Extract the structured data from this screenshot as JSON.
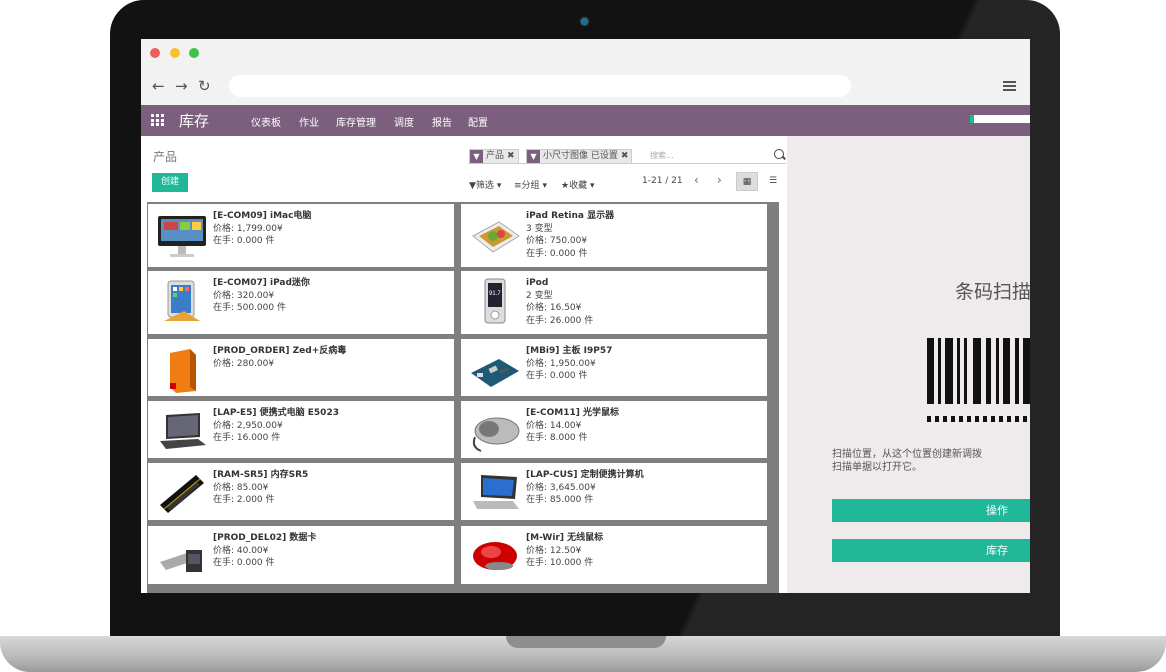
{
  "colors": {
    "brand": "#7c5f7f",
    "accent": "#21b799",
    "close": "#ee5f5b",
    "minimize": "#f7c12f",
    "maximize": "#3fc24b"
  },
  "browser": {
    "back_icon": "arrow-left-icon",
    "forward_icon": "arrow-right-icon",
    "reload_icon": "reload-icon",
    "menu_icon": "hamburger-icon"
  },
  "topbar": {
    "app_title": "库存",
    "menu": [
      "仪表板",
      "作业",
      "库存管理",
      "调度",
      "报告",
      "配置"
    ]
  },
  "control_panel": {
    "breadcrumb": "产品",
    "create_label": "创建",
    "facets": [
      {
        "label": "产品",
        "icon": "filter-icon"
      },
      {
        "label": "小尺寸图像 已设置",
        "icon": "filter-icon"
      }
    ],
    "search_placeholder": "搜索...",
    "filter_label": "筛选",
    "group_label": "分组",
    "favorites_label": "收藏",
    "pager": "1-21 / 21",
    "prev_icon": "chevron-left-icon",
    "next_icon": "chevron-right-icon"
  },
  "products": [
    {
      "title": "[E-COM09] iMac电脑",
      "lines": [
        "价格: 1,799.00¥",
        "在手:  0.000 件"
      ],
      "icon": "imac"
    },
    {
      "title": "iPad Retina 显示器",
      "lines": [
        "3 变型",
        "价格: 750.00¥",
        "在手:  0.000 件"
      ],
      "icon": "ipad-retina"
    },
    {
      "title": "[E-COM07] iPad迷你",
      "lines": [
        "价格: 320.00¥",
        "在手:  500.000 件"
      ],
      "icon": "ipad-mini"
    },
    {
      "title": "iPod",
      "lines": [
        "2 变型",
        "价格: 16.50¥",
        "在手:  26.000 件"
      ],
      "icon": "ipod"
    },
    {
      "title": "[PROD_ORDER] Zed+反病毒",
      "lines": [
        "价格: 280.00¥"
      ],
      "icon": "software-box"
    },
    {
      "title": "[MBi9] 主板 I9P57",
      "lines": [
        "价格: 1,950.00¥",
        "在手:  0.000 件"
      ],
      "icon": "motherboard"
    },
    {
      "title": "[LAP-E5] 便携式电脑 E5023",
      "lines": [
        "价格: 2,950.00¥",
        "在手:  16.000 件"
      ],
      "icon": "laptop"
    },
    {
      "title": "[E-COM11] 光学鼠标",
      "lines": [
        "价格: 14.00¥",
        "在手:  8.000 件"
      ],
      "icon": "optical-mouse"
    },
    {
      "title": "[RAM-SR5] 内存SR5",
      "lines": [
        "价格: 85.00¥",
        "在手:  2.000 件"
      ],
      "icon": "ram"
    },
    {
      "title": "[LAP-CUS] 定制便携计算机",
      "lines": [
        "价格: 3,645.00¥",
        "在手:  85.000 件"
      ],
      "icon": "laptop-blue"
    },
    {
      "title": "[PROD_DEL02] 数据卡",
      "lines": [
        "价格: 40.00¥",
        "在手:  0.000 件"
      ],
      "icon": "data-card"
    },
    {
      "title": "[M-Wir] 无线鼠标",
      "lines": [
        "价格: 12.50¥",
        "在手:  10.000 件"
      ],
      "icon": "wireless-mouse"
    }
  ],
  "barcode_panel": {
    "title": "条码扫描",
    "description_line1": "扫描位置，从这个位置创建新调拨",
    "description_line2": "扫描单据以打开它。",
    "button_operations": "操作",
    "button_inventory": "库存"
  }
}
